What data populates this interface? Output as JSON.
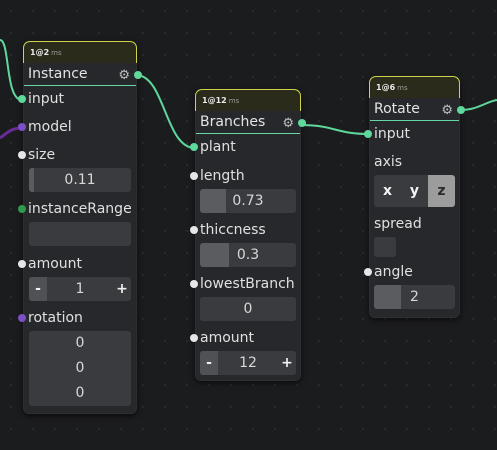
{
  "nodes": {
    "instance": {
      "timing_value": "1@2",
      "timing_unit": "ms",
      "title": "Instance",
      "rows": {
        "input": "input",
        "model": "model",
        "size": "size",
        "size_value": "0.11",
        "instance_range": "instanceRange",
        "amount": "amount",
        "amount_value": "1",
        "rotation": "rotation",
        "rotation_x": "0",
        "rotation_y": "0",
        "rotation_z": "0"
      }
    },
    "branches": {
      "timing_value": "1@12",
      "timing_unit": "ms",
      "title": "Branches",
      "rows": {
        "plant": "plant",
        "length": "length",
        "length_value": "0.73",
        "length_fill": 0.27,
        "thiccness": "thiccness",
        "thiccness_value": "0.3",
        "thiccness_fill": 0.3,
        "lowest_branch": "lowestBranch",
        "lowest_branch_value": "0",
        "amount": "amount",
        "amount_value": "12"
      }
    },
    "rotate": {
      "timing_value": "1@6",
      "timing_unit": "ms",
      "title": "Rotate",
      "rows": {
        "input": "input",
        "axis": "axis",
        "axis_x": "x",
        "axis_y": "y",
        "axis_z": "z",
        "axis_selected": "z",
        "spread": "spread",
        "angle": "angle",
        "angle_value": "2",
        "angle_fill": 0.33
      }
    }
  },
  "stepper": {
    "minus": "-",
    "plus": "+"
  },
  "colors": {
    "wire": "#5fd89c",
    "wire_purple": "#6a2c9b",
    "timing_border": "#cfd44c",
    "header_underline": "#67d8a3"
  },
  "icons": {
    "gear": "gear-icon"
  }
}
